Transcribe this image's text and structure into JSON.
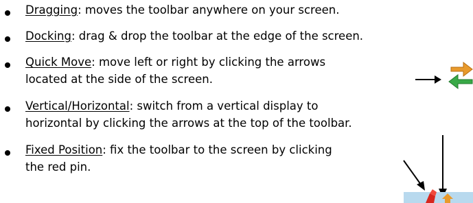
{
  "bullets": [
    {
      "term": "Dragging",
      "lines": [
        ": moves the toolbar anywhere on your screen."
      ]
    },
    {
      "term": "Docking",
      "lines": [
        ": drag & drop the toolbar at the edge of the screen."
      ]
    },
    {
      "term": "Quick Move",
      "lines": [
        ": move left or right by clicking the arrows",
        "located at the side of the screen."
      ]
    },
    {
      "term": "Vertical/Horizontal",
      "lines": [
        ": switch from a vertical display to",
        "horizontal by clicking the arrows at the top of the toolbar."
      ]
    },
    {
      "term": "Fixed Position",
      "lines": [
        ": fix the toolbar to the screen by clicking",
        "the red pin."
      ]
    }
  ],
  "icons": {
    "quick_move": "swap-arrows-icon",
    "fixed_position": "toolbar-pin-icon"
  },
  "colors": {
    "text": "#000000",
    "arrow_orange": "#e89a2c",
    "arrow_green": "#39a947",
    "pin_red": "#d7261e",
    "toolbar_blue": "#b8d9ee"
  }
}
